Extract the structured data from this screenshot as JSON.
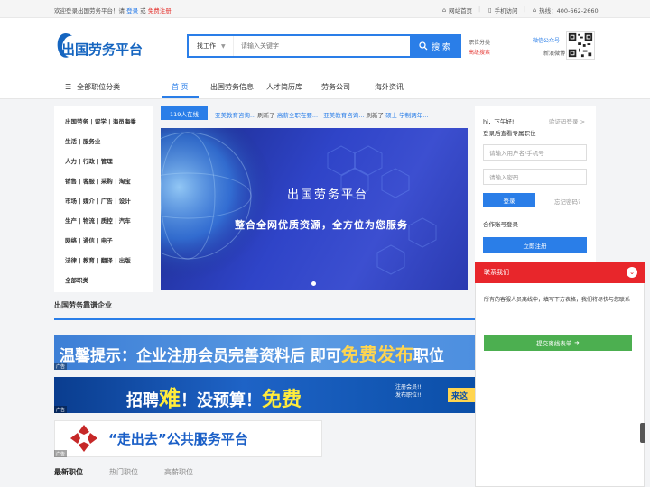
{
  "topbar": {
    "welcome": "欢迎登录出国劳务平台！请",
    "login": "登录",
    "or": "或",
    "register": "免费注册",
    "home": "网站首页",
    "mobile": "手机访问",
    "hotline": "热线：400-662-2660"
  },
  "header": {
    "logo": "出国劳务平台",
    "search_type": "找工作",
    "search_placeholder": "请输入关键字",
    "search_button": "搜 索",
    "link_job_category": "职位分类",
    "link_high_salary": "高级搜索",
    "wechat": "微信公众号",
    "weibo": "新浪微博"
  },
  "nav": {
    "all_categories": "全部职位分类",
    "items": [
      "首 页",
      "出国劳务信息",
      "人才简历库",
      "劳务公司",
      "海外资讯"
    ]
  },
  "categories": [
    "出国劳务 | 留学 | 海员海乘",
    "生活 | 服务业",
    "人力 | 行政 | 管理",
    "销售 | 客服 | 采购 | 淘宝",
    "市场 | 媒介 | 广告 | 设计",
    "生产 | 物流 | 质控 | 汽车",
    "网络 | 通信 | 电子",
    "法律 | 教育 | 翻译 | 出版",
    "全部职类"
  ],
  "ticker": {
    "online": "119人在线",
    "item1_company": "亚美教育咨询...",
    "item1_action": "刷新了",
    "item1_job": "高薪全职在要...",
    "item2_company": "亚美教育咨询...",
    "item2_action": "刷新了",
    "item2_job": "硕士 学制两年..."
  },
  "banner": {
    "title": "出国劳务平台",
    "subtitle": "整合全网优质资源，全方位为您服务"
  },
  "login": {
    "greeting": "hi，下午好!",
    "verify_link": "验证码登录 >",
    "hint": "登录后查看专属职位",
    "username_placeholder": "请输入用户名/手机号",
    "password_placeholder": "请输入密码",
    "login_button": "登录",
    "forgot": "忘记密码?",
    "partner_login": "合作账号登录",
    "register_button": "立即注册"
  },
  "contact": {
    "title": "联系我们",
    "close": "⌄",
    "message": "所有的客服人员离线中，填写下方表格，我们将尽快与您联系",
    "submit": "提交离线表单"
  },
  "section": {
    "title": "出国劳务靠谱企业"
  },
  "ads": {
    "ad1_prefix": "温馨提示：企业注册会员完善资料后  即可",
    "ad1_highlight": "免费发布",
    "ad1_suffix": "职位",
    "ad2_prefix": "招聘",
    "ad2_hl1": "难",
    "ad2_mid": "！没预算！",
    "ad2_hl2": "免费",
    "ad2_small1": "注册会员!!",
    "ad2_small2": "发布职位!!",
    "ad2_tag": "来这",
    "ad3_text": "“走出去”公共服务平台",
    "ad_label": "广告"
  },
  "tabs": [
    "最新职位",
    "热门职位",
    "高薪职位"
  ],
  "colors": {
    "primary": "#2a7ee8",
    "contact_red": "#e8262b",
    "submit_green": "#4caf50"
  }
}
